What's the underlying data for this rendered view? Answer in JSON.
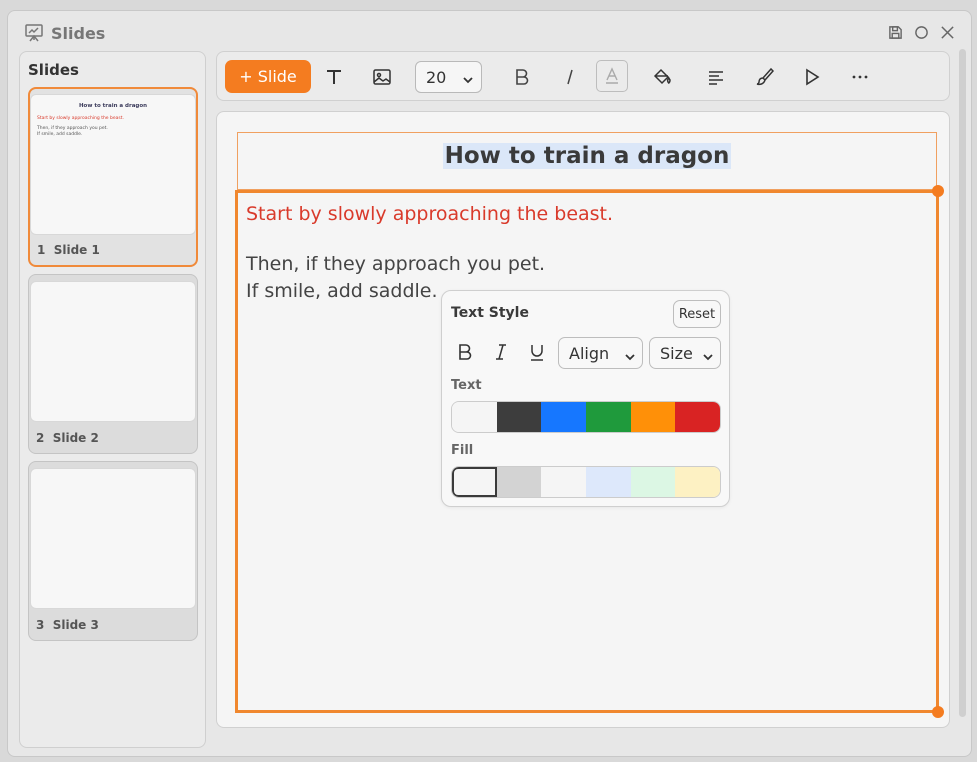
{
  "window": {
    "title": "Slides",
    "icon": "presentation-icon",
    "controls": [
      "save-icon",
      "circle-icon",
      "close-icon"
    ]
  },
  "sidebar": {
    "title": "Slides",
    "slides": [
      {
        "number": "1",
        "name": "Slide 1",
        "active": true,
        "preview": {
          "title": "How to train a dragon",
          "red": "Start by slowly approaching the beast.",
          "line1": "Then, if they approach you pet.",
          "line2": "If smile, add saddle."
        }
      },
      {
        "number": "2",
        "name": "Slide 2",
        "active": false
      },
      {
        "number": "3",
        "name": "Slide 3",
        "active": false
      }
    ]
  },
  "toolbar": {
    "add_slide_label": "+ Slide",
    "font_size": "20",
    "tools": [
      "text-tool-icon",
      "image-icon",
      "bold-icon",
      "italic-icon",
      "text-color-icon",
      "fill-bucket-icon",
      "align-icon",
      "brush-icon",
      "play-icon",
      "more-icon"
    ]
  },
  "slide": {
    "title": "How to train a dragon",
    "body_red": "Start by slowly approaching the beast.",
    "body_line1": "Then, if they approach you pet.",
    "body_line2": "If smile, add saddle."
  },
  "text_style": {
    "title": "Text Style",
    "reset_label": "Reset",
    "bold_label": "B",
    "italic_label": "I",
    "underline_label": "U",
    "align_label": "Align",
    "size_label": "Size",
    "text_section_label": "Text",
    "fill_section_label": "Fill",
    "text_colors": [
      "#f5f5f5",
      "#3d3d3d",
      "#1677ff",
      "#1f9a3c",
      "#ff9008",
      "#d92323"
    ],
    "fill_colors": [
      "#f5f5f5",
      "#d3d3d3",
      "#f5f5f5",
      "#dde8fb",
      "#dcf7e4",
      "#fdf1c3"
    ]
  },
  "colors": {
    "accent": "#f47c20",
    "text_red": "#d93a2b"
  }
}
